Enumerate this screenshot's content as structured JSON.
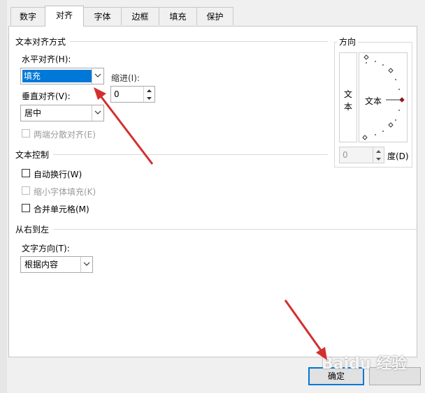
{
  "tabs": [
    {
      "label": "数字"
    },
    {
      "label": "对齐"
    },
    {
      "label": "字体"
    },
    {
      "label": "边框"
    },
    {
      "label": "填充"
    },
    {
      "label": "保护"
    }
  ],
  "text_alignment": {
    "section_title": "文本对齐方式",
    "horizontal_label": "水平对齐(H):",
    "horizontal_value": "填充",
    "indent_label": "缩进(I):",
    "indent_value": "0",
    "vertical_label": "垂直对齐(V):",
    "vertical_value": "居中",
    "justify_distributed_label": "两端分散对齐(E)"
  },
  "text_control": {
    "section_title": "文本控制",
    "wrap_text_label": "自动换行(W)",
    "shrink_to_fit_label": "缩小字体填充(K)",
    "merge_cells_label": "合并单元格(M)"
  },
  "rtl": {
    "section_title": "从右到左",
    "direction_label": "文字方向(T):",
    "direction_value": "根据内容"
  },
  "orientation": {
    "section_title": "方向",
    "vertical_text": "文本",
    "dial_text": "文本",
    "degrees_value": "0",
    "degrees_label": "度(D)"
  },
  "buttons": {
    "ok_label": "确定"
  },
  "watermark": {
    "text": "Baidu 经验"
  },
  "colors": {
    "accent": "#0078d7",
    "arrow": "#d32f2f"
  }
}
